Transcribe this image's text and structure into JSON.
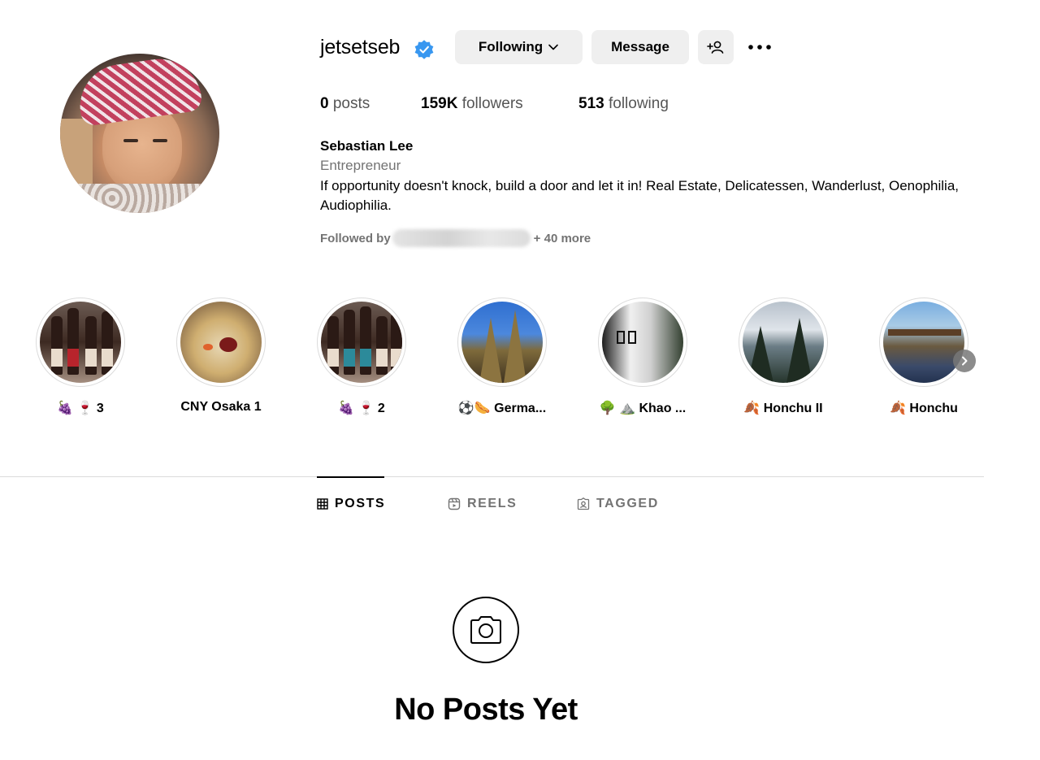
{
  "profile": {
    "username": "jetsetseb",
    "verified": true,
    "following_label": "Following",
    "message_label": "Message",
    "stats": {
      "posts_count": "0",
      "posts_label": "posts",
      "followers_count": "159K",
      "followers_label": "followers",
      "following_count": "513",
      "following_label": "following"
    },
    "full_name": "Sebastian Lee",
    "category": "Entrepreneur",
    "bio": "If opportunity doesn't knock, build a door and let it in! Real Estate, Delicatessen, Wanderlust, Oenophilia, Audiophilia.",
    "followed_by_prefix": "Followed by",
    "followed_by_suffix": "+ 40 more"
  },
  "highlights": [
    {
      "label": "🍇 🍷 3",
      "image": "wine-bottles"
    },
    {
      "label": "CNY Osaka 1",
      "image": "soup-bowl"
    },
    {
      "label": "🍇 🍷 2",
      "image": "wine-bottles"
    },
    {
      "label": "⚽🌭 Germa...",
      "image": "cathedral"
    },
    {
      "label": "🌳 ⛰️ Khao ...",
      "image": "temple"
    },
    {
      "label": "🍂 Honchu II",
      "image": "lake-trees"
    },
    {
      "label": "🍂 Honchu",
      "image": "pool-building"
    }
  ],
  "tabs": [
    {
      "label": "POSTS",
      "icon": "grid-icon",
      "active": true
    },
    {
      "label": "REELS",
      "icon": "reels-icon",
      "active": false
    },
    {
      "label": "TAGGED",
      "icon": "tagged-icon",
      "active": false
    }
  ],
  "empty_state": {
    "icon": "camera-icon",
    "title": "No Posts Yet"
  },
  "colors": {
    "button_bg": "#efefef",
    "secondary_text": "#737373",
    "verified_blue": "#3897f0",
    "divider": "#dbdbdb"
  }
}
